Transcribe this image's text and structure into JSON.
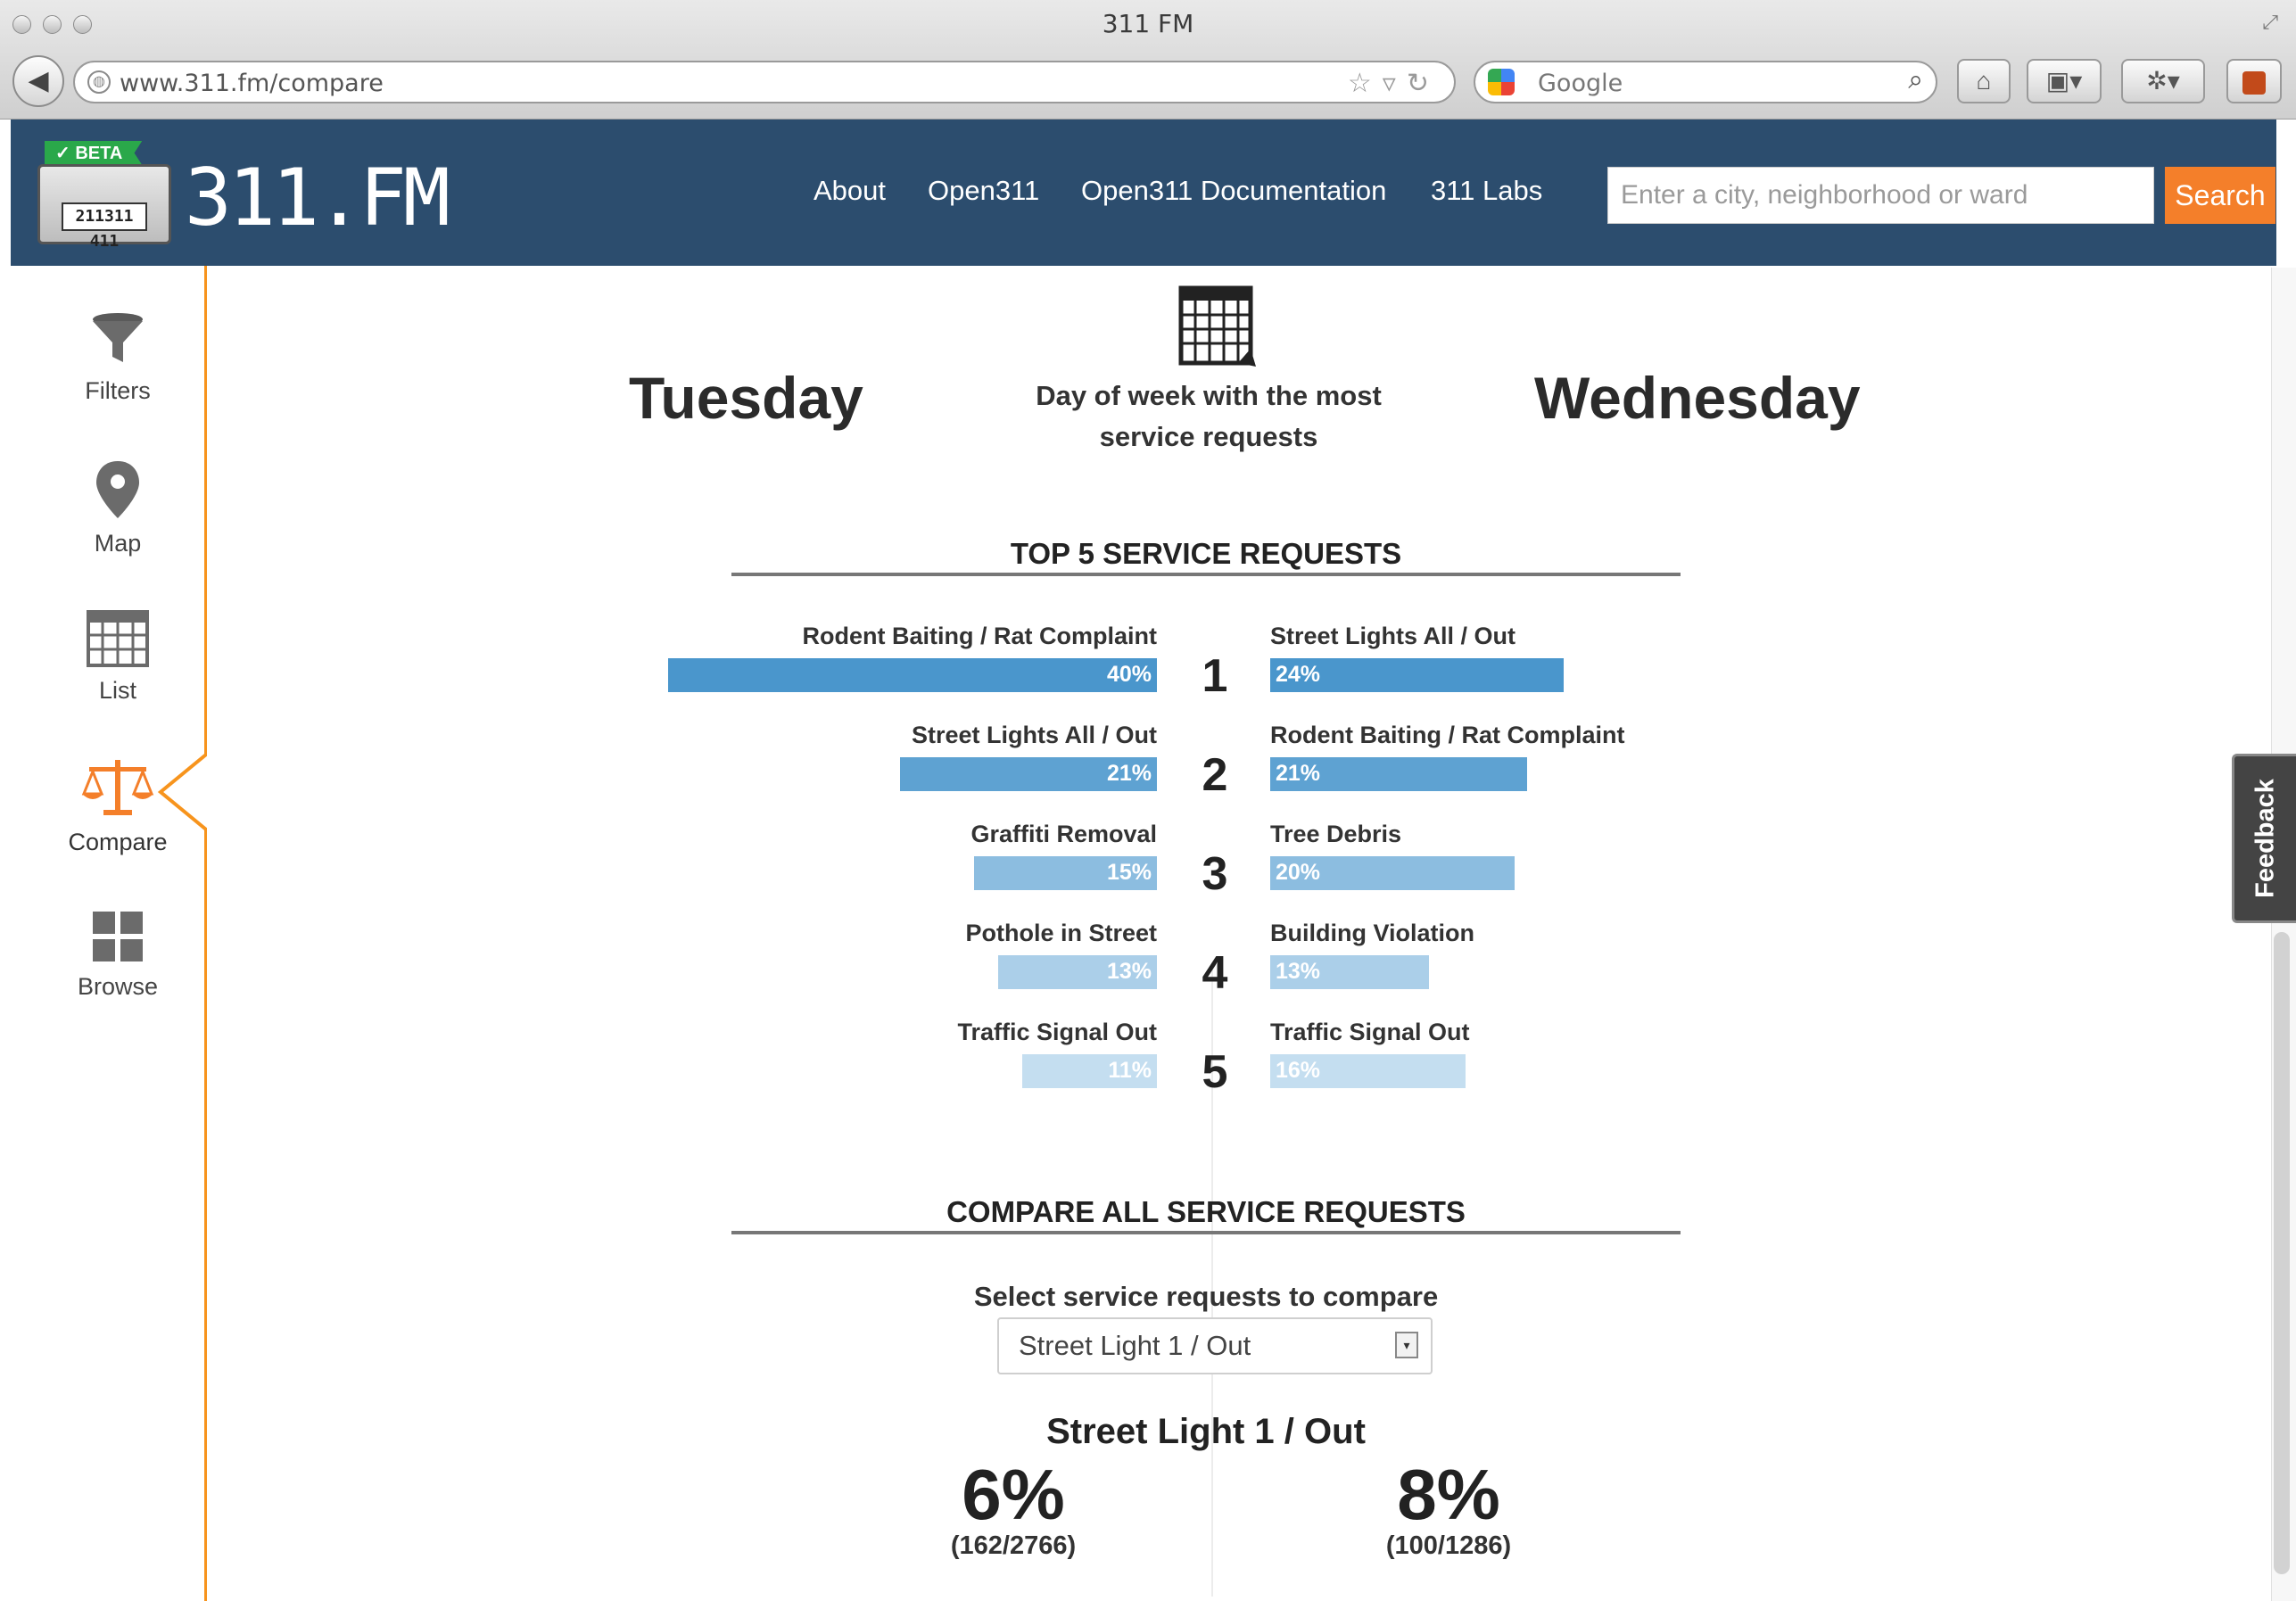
{
  "window": {
    "title": "311 FM"
  },
  "browser": {
    "url": "www.311.fm/compare",
    "search_engine": "Google",
    "icons": [
      "back-icon",
      "globe-icon",
      "star-icon",
      "reload-icon",
      "google-icon",
      "search-icon",
      "home-icon",
      "bookmarks-icon",
      "addons-icon",
      "extension-icon"
    ]
  },
  "header": {
    "badge": "BETA",
    "radio_display": "211311 411",
    "logo": "311.FM",
    "nav": [
      {
        "label": "About"
      },
      {
        "label": "Open311"
      },
      {
        "label": "Open311 Documentation"
      },
      {
        "label": "311 Labs"
      }
    ],
    "search": {
      "placeholder": "Enter a city, neighborhood or ward",
      "button": "Search"
    }
  },
  "sidebar": {
    "items": [
      {
        "label": "Filters",
        "icon": "filter-icon"
      },
      {
        "label": "Map",
        "icon": "map-pin-icon"
      },
      {
        "label": "List",
        "icon": "list-grid-icon"
      },
      {
        "label": "Compare",
        "icon": "scale-icon",
        "active": true
      },
      {
        "label": "Browse",
        "icon": "browse-tiles-icon"
      }
    ],
    "accent_color": "#f7941d"
  },
  "compare": {
    "left_day": "Tuesday",
    "right_day": "Wednesday",
    "day_description_1": "Day of week with the most",
    "day_description_2": "service requests",
    "top5_title": "TOP 5 SERVICE REQUESTS",
    "ranks": [
      "1",
      "2",
      "3",
      "4",
      "5"
    ],
    "left": [
      {
        "label": "Rodent Baiting / Rat Complaint",
        "pct": "40%",
        "value": 40
      },
      {
        "label": "Street Lights All / Out",
        "pct": "21%",
        "value": 21
      },
      {
        "label": "Graffiti Removal",
        "pct": "15%",
        "value": 15
      },
      {
        "label": "Pothole in Street",
        "pct": "13%",
        "value": 13
      },
      {
        "label": "Traffic Signal Out",
        "pct": "11%",
        "value": 11
      }
    ],
    "right": [
      {
        "label": "Street Lights All / Out",
        "pct": "24%",
        "value": 24
      },
      {
        "label": "Rodent Baiting / Rat Complaint",
        "pct": "21%",
        "value": 21
      },
      {
        "label": "Tree Debris",
        "pct": "20%",
        "value": 20
      },
      {
        "label": "Building Violation",
        "pct": "13%",
        "value": 13
      },
      {
        "label": "Traffic Signal Out",
        "pct": "16%",
        "value": 16
      }
    ],
    "bar_colors": [
      "#4a96cc",
      "#5ea2d2",
      "#8cbde0",
      "#abcfe9",
      "#c4def0"
    ],
    "all_title": "COMPARE ALL SERVICE REQUESTS",
    "select_label": "Select service requests to compare",
    "select_value": "Street Light 1 / Out",
    "selected_title": "Street Light 1 / Out",
    "left_pct": "6%",
    "left_fraction": "(162/2766)",
    "right_pct": "8%",
    "right_fraction": "(100/1286)"
  },
  "feedback": {
    "label": "Feedback"
  }
}
